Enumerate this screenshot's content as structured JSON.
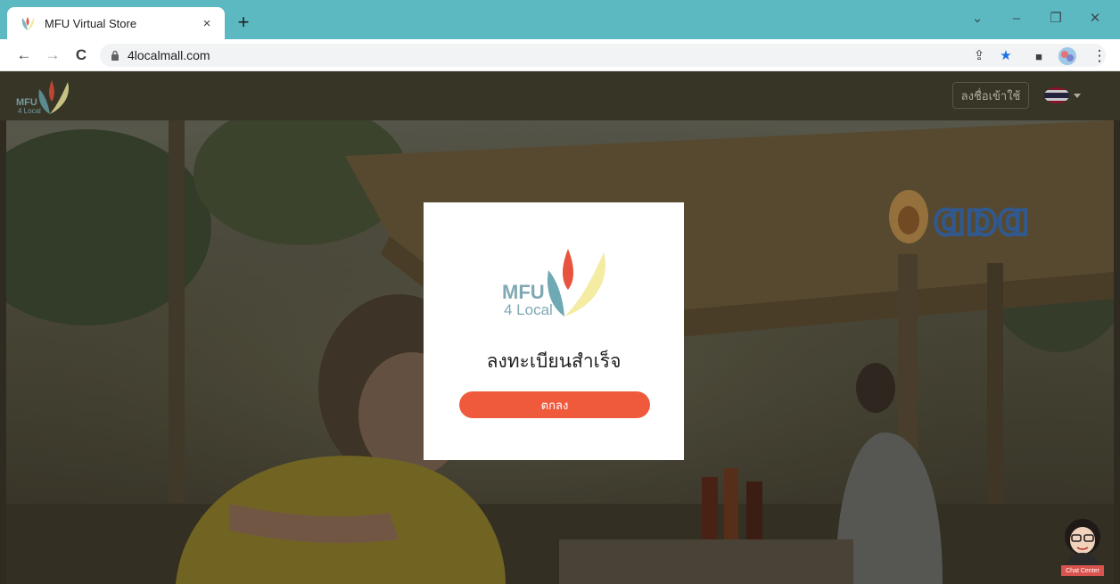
{
  "browser": {
    "tab_title": "MFU Virtual Store",
    "tab_close": "×",
    "new_tab": "+",
    "url": "4localmall.com",
    "nav": {
      "back": "←",
      "forward": "→",
      "reload": "C"
    },
    "window_controls": {
      "collapse": "⌄",
      "minimize": "–",
      "restore": "❐",
      "close": "✕"
    },
    "omnibox_icons": {
      "share": "⇪",
      "bookmark": "★",
      "sidebar": "■",
      "menu": "⋮"
    }
  },
  "header": {
    "logo_line1": "MFU",
    "logo_line2": "4 Local",
    "login_label": "ลงชื่อเข้าใช้"
  },
  "modal": {
    "logo_line1": "MFU",
    "logo_line2": "4 Local",
    "title": "ลงทะเบียนสำเร็จ",
    "ok_label": "ตกลง"
  },
  "chat_widget": {
    "label": "Chat Center"
  },
  "colors": {
    "tabstrip": "#5cb9c1",
    "ok_button": "#ef5a3d",
    "logo_teal": "#6fa9b3",
    "logo_red": "#e8533f",
    "logo_yellow": "#f4eca3"
  }
}
